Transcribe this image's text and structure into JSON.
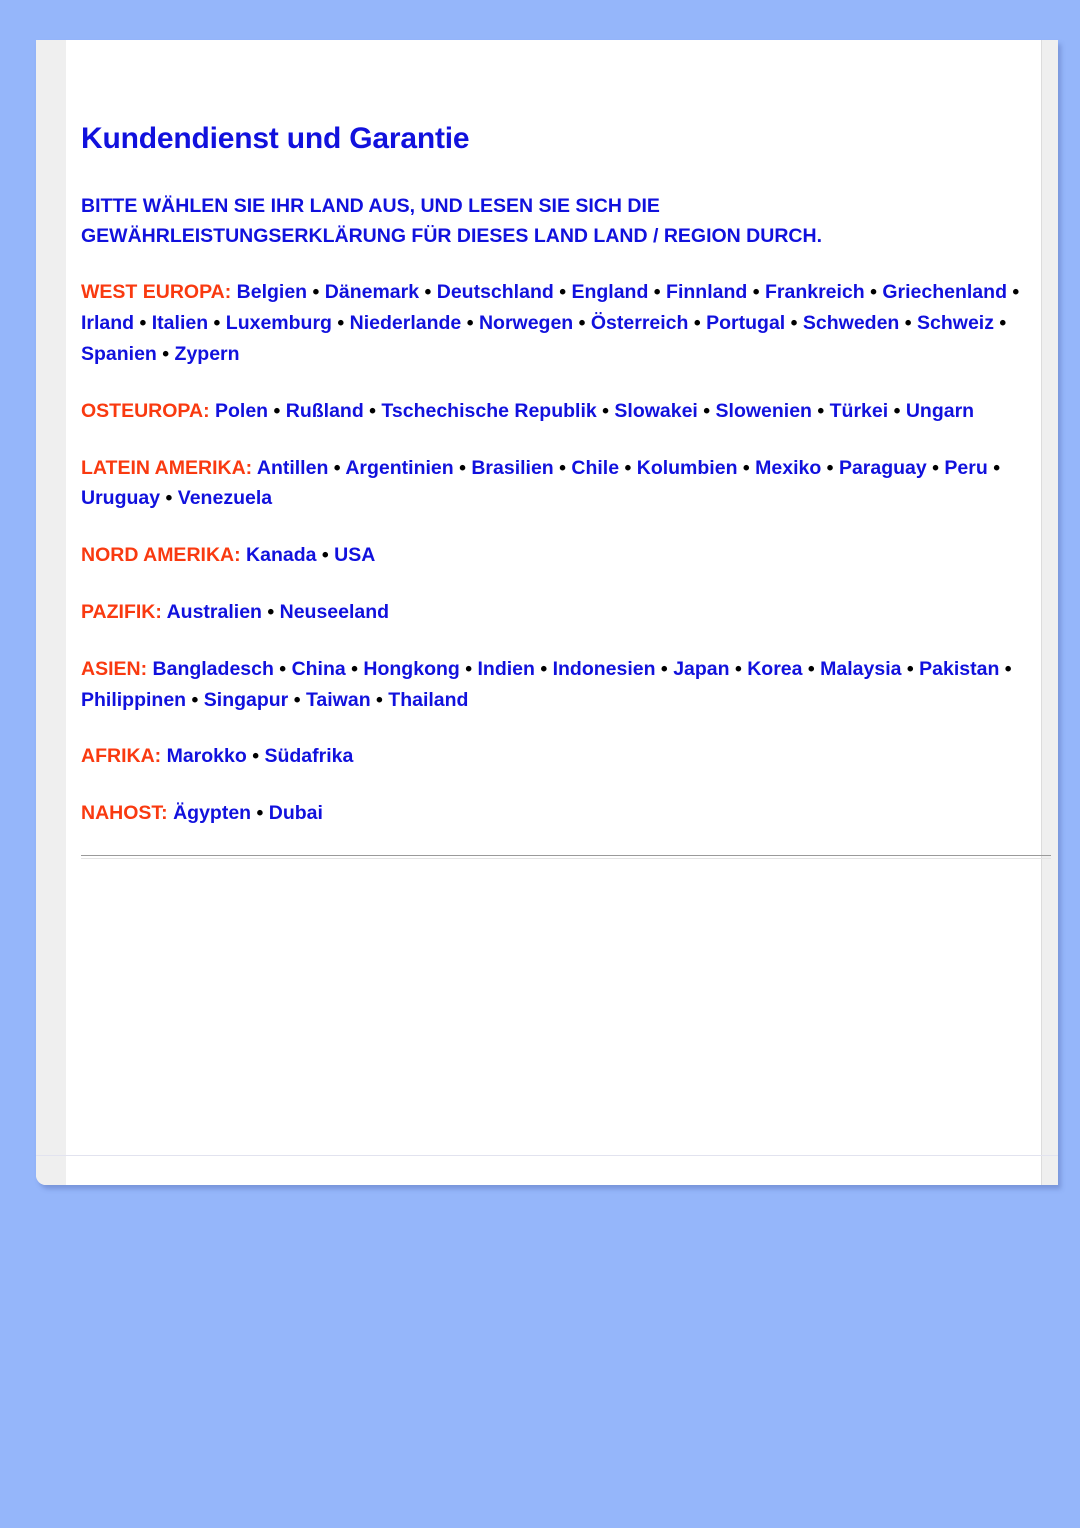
{
  "page": {
    "title": "Kundendienst und Garantie",
    "intro": "BITTE WÄHLEN SIE IHR LAND AUS, UND LESEN SIE SICH DIE GEWÄHRLEISTUNGSERKLÄRUNG FÜR DIESES LAND LAND / REGION DURCH.",
    "colors": {
      "background": "#95b6fa",
      "sheet": "#ffffff",
      "gutter": "#efefef",
      "heading_blue": "#1111dd",
      "country_blue": "#1111dd",
      "region_orange": "#f93a10",
      "bullet_black": "#000000",
      "divider": "#9a9a9a"
    }
  },
  "regions": [
    {
      "label": "WEST EUROPA:",
      "countries": [
        "Belgien",
        "Dänemark",
        "Deutschland",
        "England",
        "Finnland",
        "Frankreich",
        "Griechenland",
        "Irland",
        "Italien",
        "Luxemburg",
        "Niederlande",
        "Norwegen",
        "Österreich",
        "Portugal",
        "Schweden",
        "Schweiz",
        "Spanien",
        "Zypern"
      ],
      "countries_text": "Belgien • Dänemark • Deutschland • England • Finnland • Frankreich • Griechenland • Irland • Italien • Luxemburg • Niederlande • Norwegen • Österreich • Portugal • Schweden • Schweiz • Spanien • Zypern"
    },
    {
      "label": "OSTEUROPA:",
      "countries": [
        "Polen",
        "Rußland",
        "Tschechische Republik",
        "Slowakei",
        "Slowenien",
        "Türkei",
        "Ungarn"
      ],
      "countries_text": "Polen • Rußland • Tschechische Republik • Slowakei • Slowenien • Türkei • Ungarn"
    },
    {
      "label": "LATEIN AMERIKA:",
      "countries": [
        "Antillen",
        "Argentinien",
        "Brasilien",
        "Chile",
        "Kolumbien",
        "Mexiko",
        "Paraguay",
        "Peru",
        "Uruguay",
        "Venezuela"
      ],
      "countries_text": "Antillen • Argentinien • Brasilien • Chile • Kolumbien • Mexiko • Paraguay • Peru • Uruguay • Venezuela"
    },
    {
      "label": "NORD AMERIKA:",
      "countries": [
        "Kanada",
        "USA"
      ],
      "countries_text": "Kanada • USA"
    },
    {
      "label": "PAZIFIK:",
      "countries": [
        "Australien",
        "Neuseeland"
      ],
      "countries_text": "Australien • Neuseeland"
    },
    {
      "label": "ASIEN:",
      "countries": [
        "Bangladesch",
        "China",
        "Hongkong",
        "Indien",
        "Indonesien",
        "Japan",
        "Korea",
        "Malaysia",
        "Pakistan",
        "Philippinen",
        "Singapur",
        "Taiwan",
        "Thailand"
      ],
      "countries_text": "Bangladesch • China • Hongkong • Indien • Indonesien • Japan • Korea • Malaysia • Pakistan • Philippinen • Singapur • Taiwan • Thailand"
    },
    {
      "label": "AFRIKA:",
      "countries": [
        "Marokko",
        "Südafrika"
      ],
      "countries_text": "Marokko • Südafrika"
    },
    {
      "label": "NAHOST:",
      "countries": [
        "Ägypten",
        "Dubai"
      ],
      "countries_text": "Ägypten • Dubai"
    }
  ]
}
